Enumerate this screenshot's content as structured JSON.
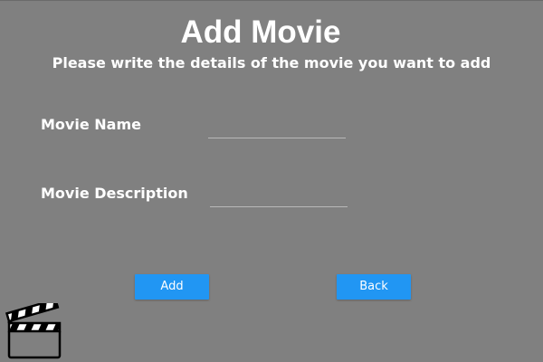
{
  "page": {
    "title": "Add Movie",
    "subtitle": "Please write the details of the movie you want to add"
  },
  "form": {
    "movie_name_label": "Movie Name",
    "movie_name_value": "",
    "movie_description_label": "Movie Description",
    "movie_description_value": ""
  },
  "actions": {
    "add_label": "Add",
    "back_label": "Back"
  },
  "colors": {
    "background": "#808080",
    "button": "#2196f3",
    "text": "#ffffff"
  },
  "icons": {
    "logo": "clapperboard-icon"
  }
}
